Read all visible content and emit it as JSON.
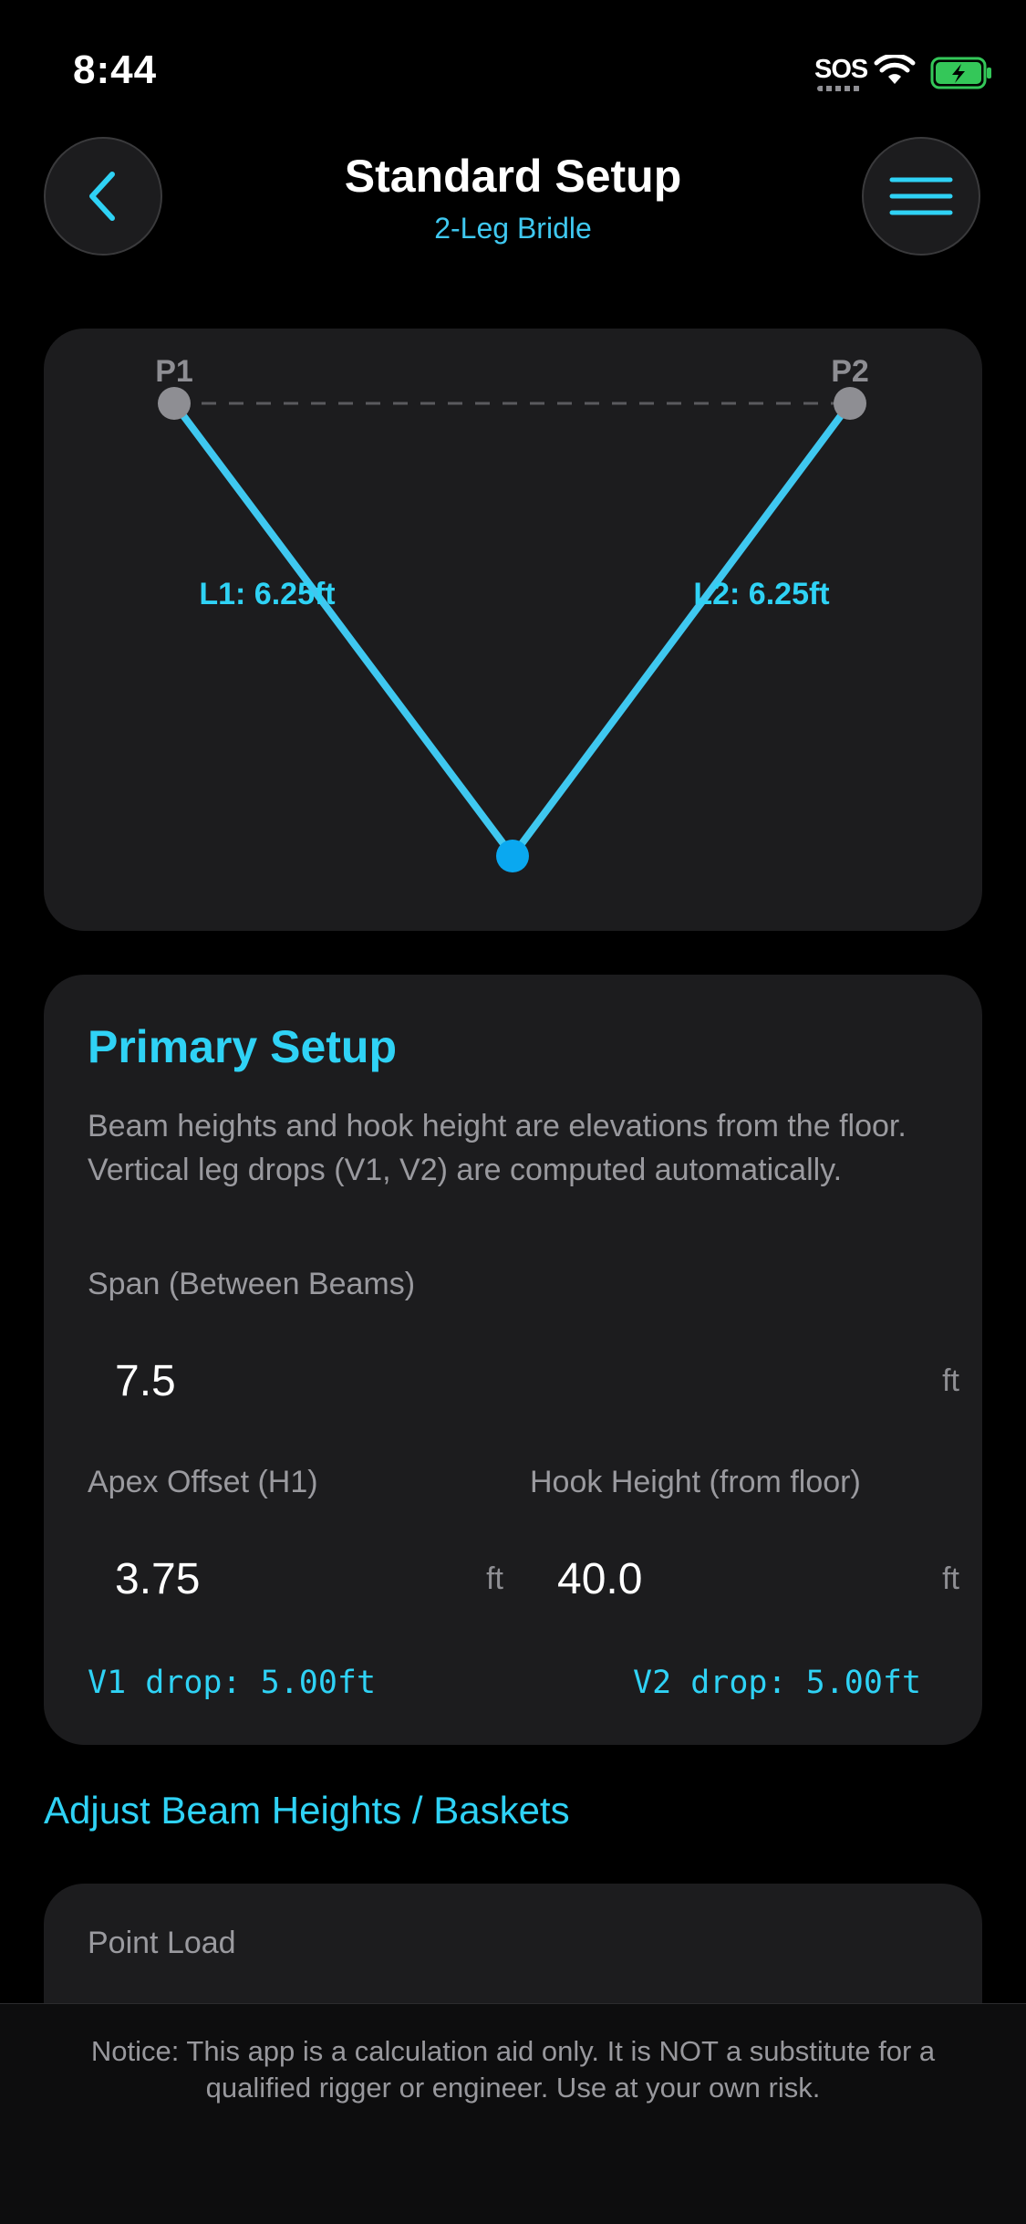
{
  "status": {
    "time": "8:44",
    "sos": "SOS"
  },
  "header": {
    "title": "Standard Setup",
    "subtitle": "2-Leg Bridle"
  },
  "diagram": {
    "p1_label": "P1",
    "p2_label": "P2",
    "l1_label": "L1: 6.25ft",
    "l2_label": "L2: 6.25ft",
    "line_color": "#3fc8f0",
    "apex_color": "#0aa8f0"
  },
  "primary_setup": {
    "title": "Primary Setup",
    "description": "Beam heights and hook height are elevations from the floor. Vertical leg drops (V1, V2) are computed automatically.",
    "span_label": "Span (Between Beams)",
    "span_value": "7.5",
    "span_unit": "ft",
    "apex_label": "Apex Offset (H1)",
    "apex_value": "3.75",
    "apex_unit": "ft",
    "hook_label": "Hook Height (from floor)",
    "hook_value": "40.0",
    "hook_unit": "ft",
    "v1_drop": "V1 drop: 5.00ft",
    "v2_drop": "V2 drop: 5.00ft"
  },
  "adjust_link": "Adjust Beam Heights / Baskets",
  "point_load": {
    "label": "Point Load"
  },
  "notice": "Notice: This app is a calculation aid only. It is NOT a substitute for a qualified rigger or engineer. Use at your own risk.",
  "colors": {
    "accent": "#2fd2f5",
    "card": "#1c1c1e",
    "background": "#000000"
  }
}
